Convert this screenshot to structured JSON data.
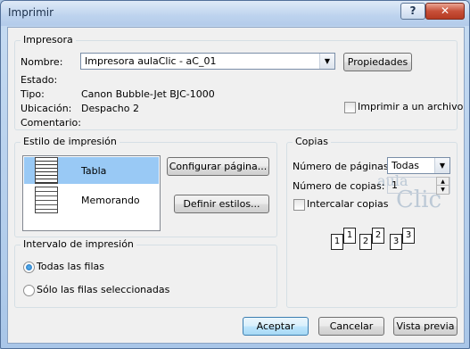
{
  "window": {
    "title": "Imprimir",
    "help_label": "?",
    "close_label": "✕"
  },
  "printer": {
    "group_title": "Impresora",
    "name_label": "Nombre:",
    "name_value": "Impresora aulaClic - aC_01",
    "properties_button": "Propiedades",
    "status_label": "Estado:",
    "status_value": "",
    "type_label": "Tipo:",
    "type_value": "Canon Bubble-Jet BJC-1000",
    "location_label": "Ubicación:",
    "location_value": "Despacho 2",
    "comment_label": "Comentario:",
    "print_to_file_label": "Imprimir a un archivo",
    "print_to_file_checked": false
  },
  "print_style": {
    "group_title": "Estilo de impresión",
    "styles": [
      {
        "label": "Tabla",
        "selected": true
      },
      {
        "label": "Memorando",
        "selected": false
      }
    ],
    "page_setup_button": "Configurar página...",
    "define_styles_button": "Definir estilos..."
  },
  "copies": {
    "group_title": "Copias",
    "pages_label": "Número de páginas:",
    "pages_value": "Todas",
    "copies_label": "Número de copias:",
    "copies_value": "1",
    "collate_label": "Intercalar copias",
    "collate_checked": false,
    "collate_pages": [
      "1",
      "1",
      "2",
      "2",
      "3",
      "3"
    ]
  },
  "print_range": {
    "group_title": "Intervalo de impresión",
    "options": [
      {
        "label": "Todas las filas",
        "selected": true
      },
      {
        "label": "Sólo las filas seleccionadas",
        "selected": false
      }
    ]
  },
  "footer": {
    "accept_button": "Aceptar",
    "cancel_button": "Cancelar",
    "preview_button": "Vista previa"
  },
  "watermark": {
    "word1": "aula",
    "word2": "Clic"
  }
}
